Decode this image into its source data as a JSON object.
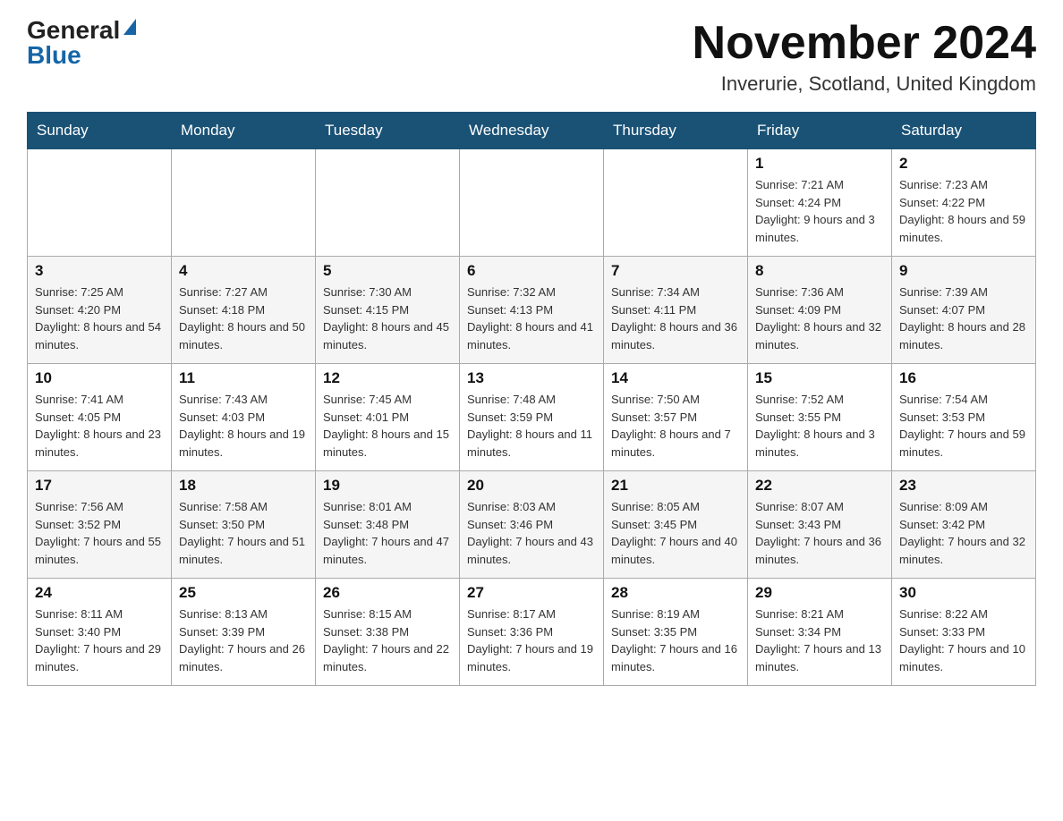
{
  "header": {
    "logo_general": "General",
    "logo_blue": "Blue",
    "month_title": "November 2024",
    "location": "Inverurie, Scotland, United Kingdom"
  },
  "days_of_week": [
    "Sunday",
    "Monday",
    "Tuesday",
    "Wednesday",
    "Thursday",
    "Friday",
    "Saturday"
  ],
  "weeks": [
    [
      {
        "day": "",
        "info": ""
      },
      {
        "day": "",
        "info": ""
      },
      {
        "day": "",
        "info": ""
      },
      {
        "day": "",
        "info": ""
      },
      {
        "day": "",
        "info": ""
      },
      {
        "day": "1",
        "info": "Sunrise: 7:21 AM\nSunset: 4:24 PM\nDaylight: 9 hours and 3 minutes."
      },
      {
        "day": "2",
        "info": "Sunrise: 7:23 AM\nSunset: 4:22 PM\nDaylight: 8 hours and 59 minutes."
      }
    ],
    [
      {
        "day": "3",
        "info": "Sunrise: 7:25 AM\nSunset: 4:20 PM\nDaylight: 8 hours and 54 minutes."
      },
      {
        "day": "4",
        "info": "Sunrise: 7:27 AM\nSunset: 4:18 PM\nDaylight: 8 hours and 50 minutes."
      },
      {
        "day": "5",
        "info": "Sunrise: 7:30 AM\nSunset: 4:15 PM\nDaylight: 8 hours and 45 minutes."
      },
      {
        "day": "6",
        "info": "Sunrise: 7:32 AM\nSunset: 4:13 PM\nDaylight: 8 hours and 41 minutes."
      },
      {
        "day": "7",
        "info": "Sunrise: 7:34 AM\nSunset: 4:11 PM\nDaylight: 8 hours and 36 minutes."
      },
      {
        "day": "8",
        "info": "Sunrise: 7:36 AM\nSunset: 4:09 PM\nDaylight: 8 hours and 32 minutes."
      },
      {
        "day": "9",
        "info": "Sunrise: 7:39 AM\nSunset: 4:07 PM\nDaylight: 8 hours and 28 minutes."
      }
    ],
    [
      {
        "day": "10",
        "info": "Sunrise: 7:41 AM\nSunset: 4:05 PM\nDaylight: 8 hours and 23 minutes."
      },
      {
        "day": "11",
        "info": "Sunrise: 7:43 AM\nSunset: 4:03 PM\nDaylight: 8 hours and 19 minutes."
      },
      {
        "day": "12",
        "info": "Sunrise: 7:45 AM\nSunset: 4:01 PM\nDaylight: 8 hours and 15 minutes."
      },
      {
        "day": "13",
        "info": "Sunrise: 7:48 AM\nSunset: 3:59 PM\nDaylight: 8 hours and 11 minutes."
      },
      {
        "day": "14",
        "info": "Sunrise: 7:50 AM\nSunset: 3:57 PM\nDaylight: 8 hours and 7 minutes."
      },
      {
        "day": "15",
        "info": "Sunrise: 7:52 AM\nSunset: 3:55 PM\nDaylight: 8 hours and 3 minutes."
      },
      {
        "day": "16",
        "info": "Sunrise: 7:54 AM\nSunset: 3:53 PM\nDaylight: 7 hours and 59 minutes."
      }
    ],
    [
      {
        "day": "17",
        "info": "Sunrise: 7:56 AM\nSunset: 3:52 PM\nDaylight: 7 hours and 55 minutes."
      },
      {
        "day": "18",
        "info": "Sunrise: 7:58 AM\nSunset: 3:50 PM\nDaylight: 7 hours and 51 minutes."
      },
      {
        "day": "19",
        "info": "Sunrise: 8:01 AM\nSunset: 3:48 PM\nDaylight: 7 hours and 47 minutes."
      },
      {
        "day": "20",
        "info": "Sunrise: 8:03 AM\nSunset: 3:46 PM\nDaylight: 7 hours and 43 minutes."
      },
      {
        "day": "21",
        "info": "Sunrise: 8:05 AM\nSunset: 3:45 PM\nDaylight: 7 hours and 40 minutes."
      },
      {
        "day": "22",
        "info": "Sunrise: 8:07 AM\nSunset: 3:43 PM\nDaylight: 7 hours and 36 minutes."
      },
      {
        "day": "23",
        "info": "Sunrise: 8:09 AM\nSunset: 3:42 PM\nDaylight: 7 hours and 32 minutes."
      }
    ],
    [
      {
        "day": "24",
        "info": "Sunrise: 8:11 AM\nSunset: 3:40 PM\nDaylight: 7 hours and 29 minutes."
      },
      {
        "day": "25",
        "info": "Sunrise: 8:13 AM\nSunset: 3:39 PM\nDaylight: 7 hours and 26 minutes."
      },
      {
        "day": "26",
        "info": "Sunrise: 8:15 AM\nSunset: 3:38 PM\nDaylight: 7 hours and 22 minutes."
      },
      {
        "day": "27",
        "info": "Sunrise: 8:17 AM\nSunset: 3:36 PM\nDaylight: 7 hours and 19 minutes."
      },
      {
        "day": "28",
        "info": "Sunrise: 8:19 AM\nSunset: 3:35 PM\nDaylight: 7 hours and 16 minutes."
      },
      {
        "day": "29",
        "info": "Sunrise: 8:21 AM\nSunset: 3:34 PM\nDaylight: 7 hours and 13 minutes."
      },
      {
        "day": "30",
        "info": "Sunrise: 8:22 AM\nSunset: 3:33 PM\nDaylight: 7 hours and 10 minutes."
      }
    ]
  ]
}
